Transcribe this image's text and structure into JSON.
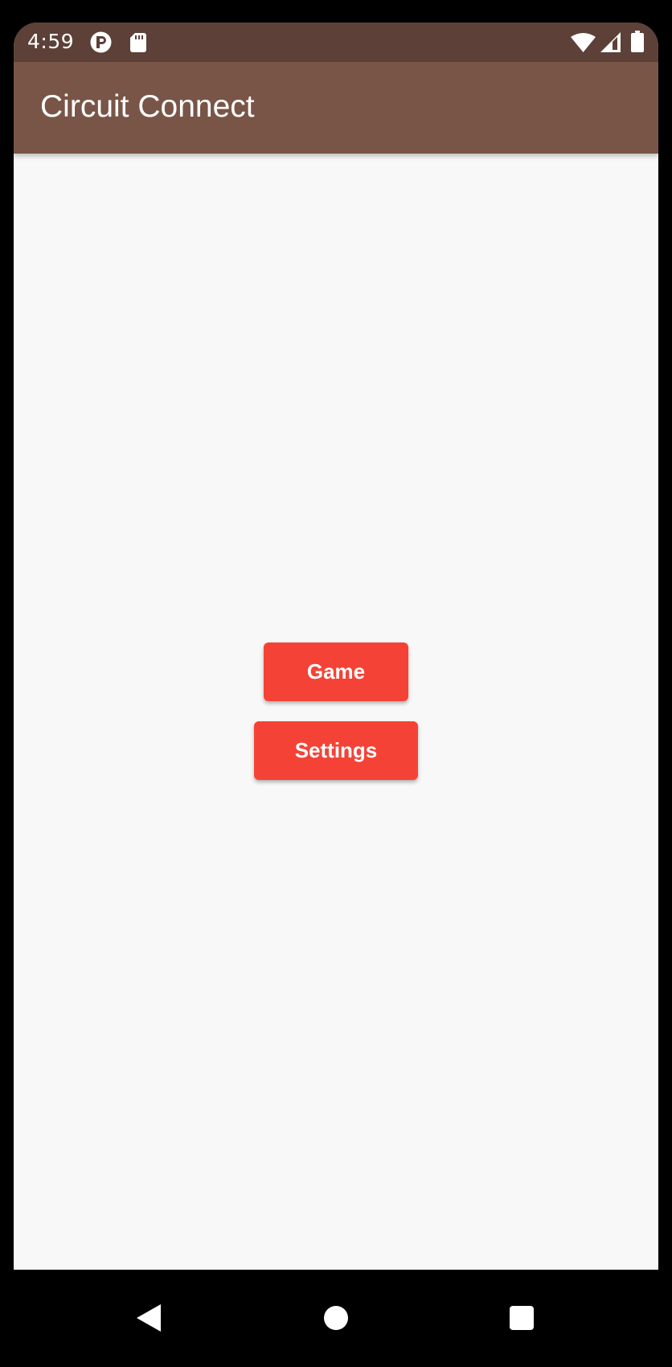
{
  "status_bar": {
    "time": "4:59",
    "left_icons": [
      "app-notification-icon",
      "sd-card-icon"
    ],
    "right_icons": [
      "wifi-icon",
      "cell-signal-icon",
      "battery-icon"
    ],
    "background": "#5d4037"
  },
  "app_bar": {
    "title": "Circuit Connect",
    "background": "#795548"
  },
  "main": {
    "buttons": [
      {
        "label": "Game",
        "color": "#f44336"
      },
      {
        "label": "Settings",
        "color": "#f44336"
      }
    ],
    "background": "#f8f8f8"
  },
  "nav_bar": {
    "buttons": [
      "back-icon",
      "home-icon",
      "recents-icon"
    ]
  }
}
